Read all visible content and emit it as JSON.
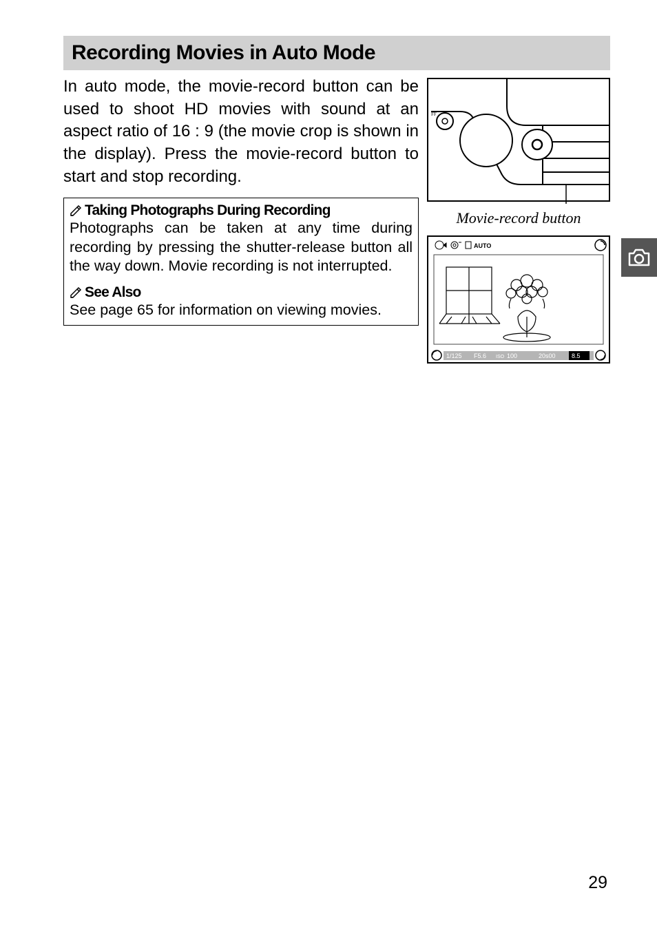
{
  "section_title": "Recording Movies in Auto Mode",
  "intro": "In auto mode, the movie-record button can be used to shoot HD movies with sound at an aspect ratio of 16 : 9 (the movie crop is shown in the display). Press the movie-record button to start and stop recording.",
  "diagram_caption": "Movie-record button",
  "notes": {
    "note1_title": "Taking Photographs During Recording",
    "note1_body": "Photographs can be taken at any time during recording by pressing the shutter-release button all the way down. Movie recording is not interrupted.",
    "note2_title": "See Also",
    "note2_body": "See page 65 for information on viewing movies."
  },
  "lcd": {
    "off_label": "FF",
    "auto_label": "AUTO",
    "shutter": "1/125",
    "aperture": "F5.6",
    "iso_label": "ISO",
    "iso": "100",
    "time": "20s00",
    "bat": "8.5"
  },
  "page_number": "29"
}
